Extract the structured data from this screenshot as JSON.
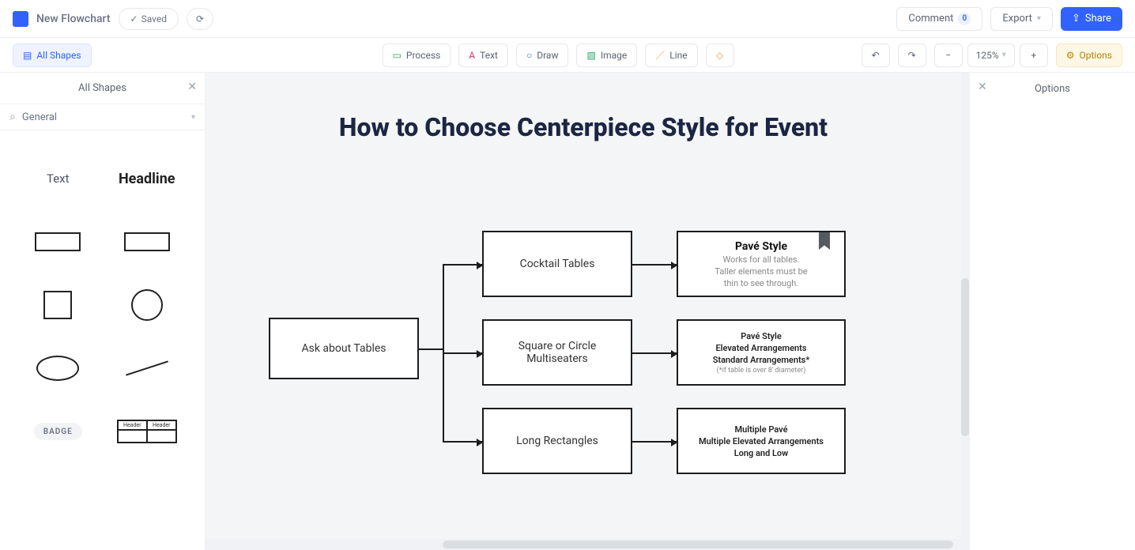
{
  "header": {
    "doc_title": "New Flowchart",
    "saved_label": "Saved",
    "comment_label": "Comment",
    "comment_count": "0",
    "export_label": "Export",
    "share_label": "Share"
  },
  "toolbar": {
    "all_shapes": "All Shapes",
    "process": "Process",
    "text": "Text",
    "draw": "Draw",
    "image": "Image",
    "line": "Line",
    "zoom_value": "125%",
    "options": "Options"
  },
  "left_panel": {
    "title": "All Shapes",
    "search_value": "General",
    "text_label": "Text",
    "headline_label": "Headline",
    "badge_label": "BADGE",
    "mini_header": "Header",
    "mini_header2": "Header"
  },
  "right_panel": {
    "title": "Options"
  },
  "chart_data": {
    "type": "flow",
    "title": "How to Choose Centerpiece Style for Event",
    "nodes": [
      {
        "id": "n1",
        "label": "Ask about Tables"
      },
      {
        "id": "n2",
        "label": "Cocktail Tables"
      },
      {
        "id": "n3",
        "label": "Square or Circle Multiseaters"
      },
      {
        "id": "n4",
        "label": "Long Rectangles"
      },
      {
        "id": "n5",
        "title": "Pavé Style",
        "lines": [
          "Works for all tables.",
          "Taller elements must be",
          "thin to see through."
        ],
        "bookmarked": true
      },
      {
        "id": "n6",
        "bold_lines": [
          "Pavé Style",
          "Elevated Arrangements",
          "Standard Arrangements*"
        ],
        "footnote": "(*if table is over 8' diameter)"
      },
      {
        "id": "n7",
        "bold_lines": [
          "Multiple Pavé",
          "Multiple Elevated Arrangements",
          "Long and Low"
        ]
      }
    ],
    "edges": [
      [
        "n1",
        "n2"
      ],
      [
        "n1",
        "n3"
      ],
      [
        "n1",
        "n4"
      ],
      [
        "n2",
        "n5"
      ],
      [
        "n3",
        "n6"
      ],
      [
        "n4",
        "n7"
      ]
    ]
  }
}
